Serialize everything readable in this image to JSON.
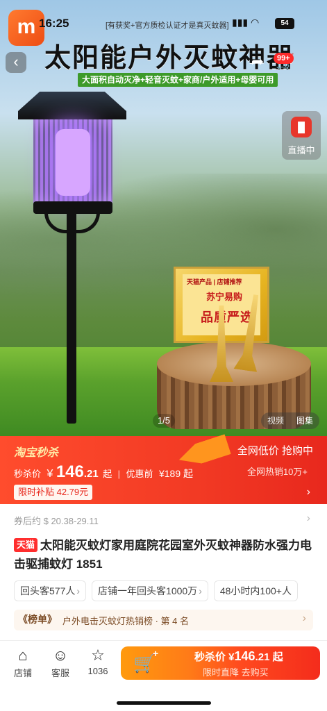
{
  "status_bar": {
    "time": "16:25",
    "banner": "[有获奖+官方质检认证才是真灭蚊器]",
    "battery": "54"
  },
  "hero": {
    "headline": "太阳能户外灭蚊神器",
    "subline": "大面积自动灭净+轻音灭蚊+家商/户外适用+母婴可用",
    "cart_badge": "99+",
    "live_label": "直播中",
    "image_counter": "1/5",
    "media_tabs": [
      "视频",
      "图集"
    ],
    "plaque": {
      "line1": "天猫产品 | 店铺推荐",
      "line2": "苏宁易购",
      "line3": "品质严选"
    }
  },
  "price_banner": {
    "brand": "淘宝秒杀",
    "price_label": "秒杀价",
    "currency": "¥",
    "price_int": "146",
    "price_dec": ".21",
    "price_suffix": "起",
    "separator": "|",
    "original_label": "优惠前",
    "original_price": "¥189 起",
    "subsidy": "限时补贴 42.79元",
    "slogan": "全网低价  抢购中",
    "sales": "全网热销10万+"
  },
  "coupon": {
    "text": "券后约 $ 20.38-29.11"
  },
  "product": {
    "tag": "天猫",
    "title": "太阳能灭蚊灯家用庭院花园室外灭蚊神器防水强力电击驱捕蚊灯 1851"
  },
  "chips": [
    {
      "label": "回头客577人"
    },
    {
      "label": "店铺一年回头客1000万"
    },
    {
      "label": "48小时内100+人"
    }
  ],
  "rank": {
    "badge": "《榜单》",
    "text": "户外电击灭蚊灯热销榜 · 第 4 名"
  },
  "bottom_nav": [
    {
      "icon": "store-icon",
      "label": "店铺"
    },
    {
      "icon": "service-icon",
      "label": "客服"
    },
    {
      "icon": "star-icon",
      "label": "1036"
    }
  ],
  "buy_button": {
    "price_text": "秒杀价 ¥",
    "price_int": "146",
    "price_dec": ".21",
    "suffix": "起",
    "sub": "限时直降  去购买"
  },
  "colors": {
    "accent": "#f23a24",
    "brand_orange": "#ff7a18",
    "live_red": "#e8362b",
    "green_sub": "#3d9a2a"
  }
}
